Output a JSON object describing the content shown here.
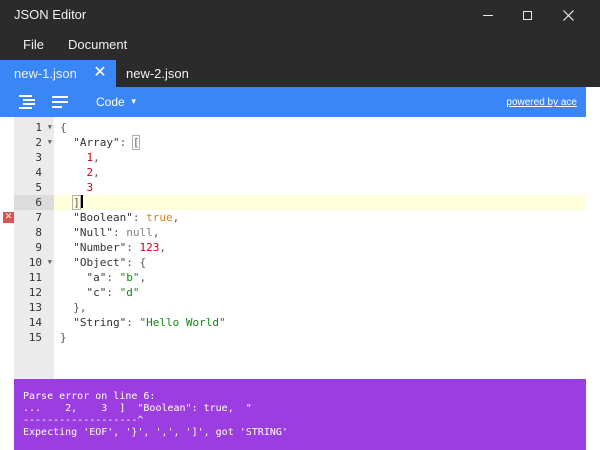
{
  "window": {
    "title": "JSON Editor"
  },
  "menu": {
    "file": "File",
    "document": "Document"
  },
  "tabs": [
    {
      "label": "new-1.json",
      "active": true,
      "close_glyph": "✕"
    },
    {
      "label": "new-2.json",
      "active": false
    }
  ],
  "toolbar": {
    "format_icon": "format-icon",
    "compact_icon": "compact-icon",
    "mode_label": "Code",
    "mode_caret": "▼",
    "powered_by": "powered by ace"
  },
  "editor": {
    "active_line": 6,
    "error_line": 7,
    "lines": [
      {
        "num": "1",
        "fold": true
      },
      {
        "num": "2",
        "fold": true
      },
      {
        "num": "3",
        "fold": false
      },
      {
        "num": "4",
        "fold": false
      },
      {
        "num": "5",
        "fold": false
      },
      {
        "num": "6",
        "fold": false
      },
      {
        "num": "7",
        "fold": false
      },
      {
        "num": "8",
        "fold": false
      },
      {
        "num": "9",
        "fold": false
      },
      {
        "num": "10",
        "fold": true
      },
      {
        "num": "11",
        "fold": false
      },
      {
        "num": "12",
        "fold": false
      },
      {
        "num": "13",
        "fold": false
      },
      {
        "num": "14",
        "fold": false
      },
      {
        "num": "15",
        "fold": false
      }
    ],
    "code": [
      [
        [
          "p",
          "{"
        ]
      ],
      [
        [
          "p",
          "  "
        ],
        [
          "k",
          "\"Array\""
        ],
        [
          "p",
          ": "
        ],
        [
          "b",
          "["
        ]
      ],
      [
        [
          "p",
          "    "
        ],
        [
          "n",
          "1"
        ],
        [
          "p",
          ","
        ]
      ],
      [
        [
          "p",
          "    "
        ],
        [
          "n",
          "2"
        ],
        [
          "p",
          ","
        ]
      ],
      [
        [
          "p",
          "    "
        ],
        [
          "n",
          "3"
        ]
      ],
      [
        [
          "p",
          "  "
        ],
        [
          "b",
          "]"
        ],
        [
          "c",
          ""
        ]
      ],
      [
        [
          "p",
          "  "
        ],
        [
          "k",
          "\"Boolean\""
        ],
        [
          "p",
          ": "
        ],
        [
          "t",
          "true"
        ],
        [
          "p",
          ","
        ]
      ],
      [
        [
          "p",
          "  "
        ],
        [
          "k",
          "\"Null\""
        ],
        [
          "p",
          ": "
        ],
        [
          "u",
          "null"
        ],
        [
          "p",
          ","
        ]
      ],
      [
        [
          "p",
          "  "
        ],
        [
          "k",
          "\"Number\""
        ],
        [
          "p",
          ": "
        ],
        [
          "n",
          "123"
        ],
        [
          "p",
          ","
        ]
      ],
      [
        [
          "p",
          "  "
        ],
        [
          "k",
          "\"Object\""
        ],
        [
          "p",
          ": {"
        ]
      ],
      [
        [
          "p",
          "    "
        ],
        [
          "k",
          "\"a\""
        ],
        [
          "p",
          ": "
        ],
        [
          "s",
          "\"b\""
        ],
        [
          "p",
          ","
        ]
      ],
      [
        [
          "p",
          "    "
        ],
        [
          "k",
          "\"c\""
        ],
        [
          "p",
          ": "
        ],
        [
          "s",
          "\"d\""
        ]
      ],
      [
        [
          "p",
          "  },"
        ]
      ],
      [
        [
          "p",
          "  "
        ],
        [
          "k",
          "\"String\""
        ],
        [
          "p",
          ": "
        ],
        [
          "s",
          "\"Hello World\""
        ]
      ],
      [
        [
          "p",
          "}"
        ]
      ]
    ]
  },
  "error": {
    "lines": [
      "Parse error on line 6:",
      "...    2,    3  ]  \"Boolean\": true,  \"",
      "-------------------^",
      "Expecting 'EOF', '}', ',', ']', got 'STRING'"
    ]
  },
  "colors": {
    "accent": "#3b86f6",
    "titlebar": "#2b2b2b",
    "error_panel": "#9b3de0",
    "number": "#d0021b",
    "string": "#118811",
    "boolean": "#d6851b"
  }
}
